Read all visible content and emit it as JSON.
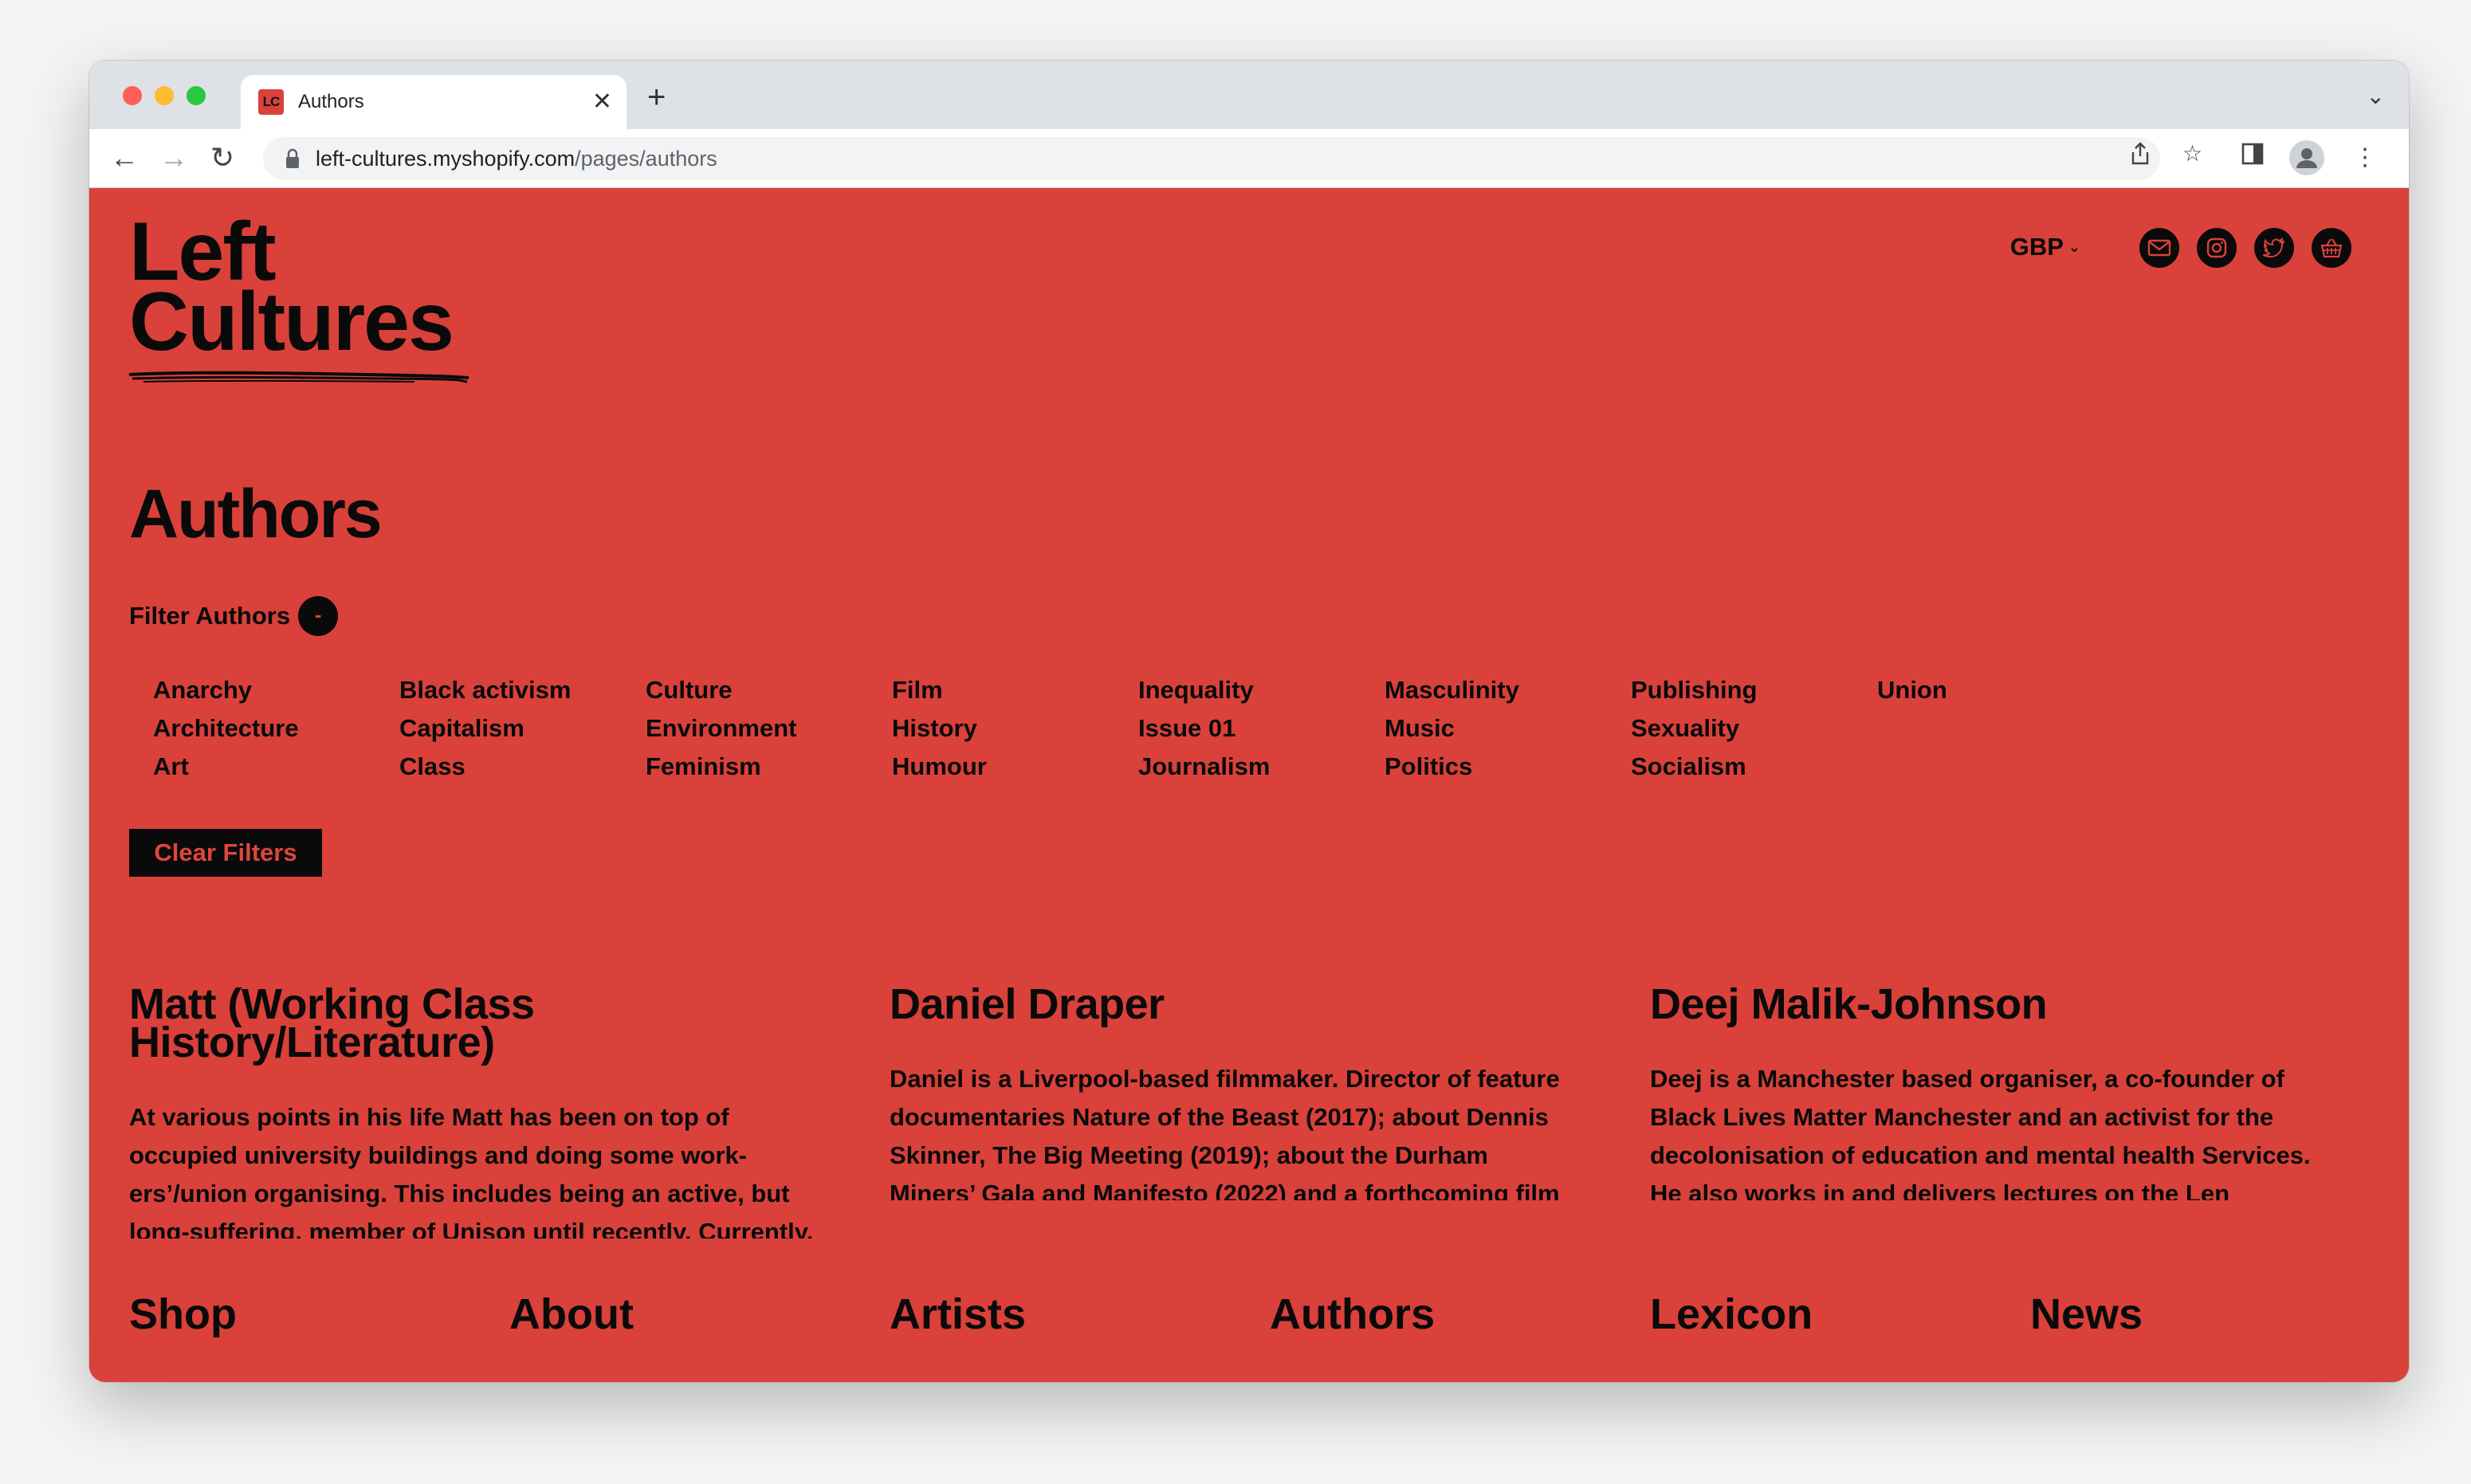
{
  "browser": {
    "tab_title": "Authors",
    "favicon_text": "LC",
    "url_host": "left-cultures.myshopify.com",
    "url_path": "/pages/authors"
  },
  "header": {
    "logo_line1": "Left",
    "logo_line2": "Cultures",
    "currency": "GBP"
  },
  "page": {
    "title": "Authors",
    "filter_label": "Filter Authors",
    "filter_toggle": "-",
    "clear_filters": "Clear Filters"
  },
  "tags": [
    "Anarchy",
    "Architecture",
    "Art",
    "Black activism",
    "Capitalism",
    "Class",
    "Culture",
    "Environment",
    "Feminism",
    "Film",
    "History",
    "Humour",
    "Inequality",
    "Issue 01",
    "Journalism",
    "Masculinity",
    "Music",
    "Politics",
    "Publishing",
    "Sexuality",
    "Socialism",
    "Union"
  ],
  "authors": [
    {
      "name": "Matt (Working Class History/Literature)",
      "bio": "At various points in his life Matt has been on top of occupied university buildings and doing some work-ers’/union organising. This includes being an active, but long-suffering, member of Unison until recently. Currently,"
    },
    {
      "name": "Daniel Draper",
      "bio": "Daniel is a Liverpool-based filmmaker. Director of feature documentaries Nature of the Beast (2017); about Dennis Skinner, The Big Meeting (2019); about the Durham Miners’ Gala and Manifesto (2022) and a forthcoming film about Walton Constituency Labour Party."
    },
    {
      "name": "Deej Malik-Johnson",
      "bio": "Deej is a Manchester based organiser, a co-founder of Black Lives Matter Manchester and an activist for the decolonisation of education and mental health Services. He also works in and delivers lectures on the Len Johnson Memorial Campaign."
    }
  ],
  "footer": [
    "Shop",
    "About",
    "Artists",
    "Authors",
    "Lexicon",
    "News"
  ],
  "colors": {
    "page_bg": "#d9413a",
    "text": "#0a0a0a"
  }
}
